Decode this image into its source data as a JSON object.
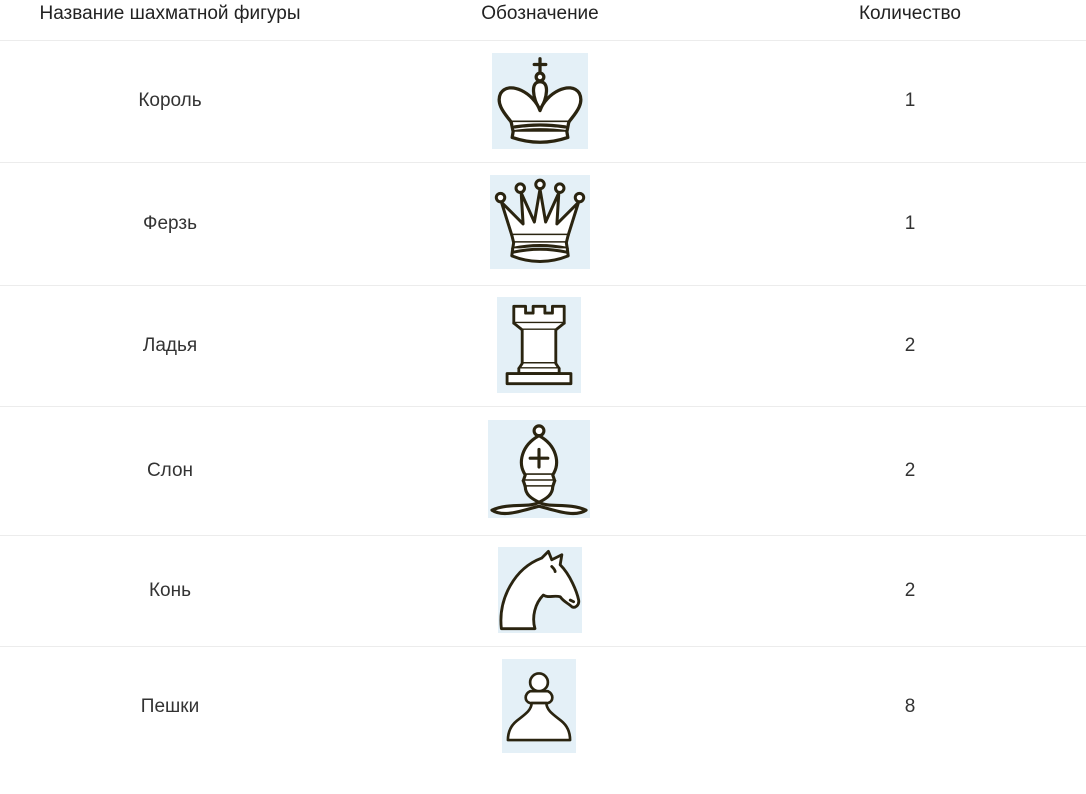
{
  "table": {
    "headers": {
      "name": "Название шахматной фигуры",
      "symbol": "Обозначение",
      "count": "Количество"
    },
    "rows": [
      {
        "name": "Король",
        "icon": "chess-king-icon",
        "count": "1"
      },
      {
        "name": "Ферзь",
        "icon": "chess-queen-icon",
        "count": "1"
      },
      {
        "name": "Ладья",
        "icon": "chess-rook-icon",
        "count": "2"
      },
      {
        "name": "Слон",
        "icon": "chess-bishop-icon",
        "count": "2"
      },
      {
        "name": "Конь",
        "icon": "chess-knight-icon",
        "count": "2"
      },
      {
        "name": "Пешки",
        "icon": "chess-pawn-icon",
        "count": "8"
      }
    ]
  },
  "colors": {
    "icon_background": "#e4f0f7",
    "icon_stroke": "#2a2410",
    "divider": "#ececec"
  }
}
